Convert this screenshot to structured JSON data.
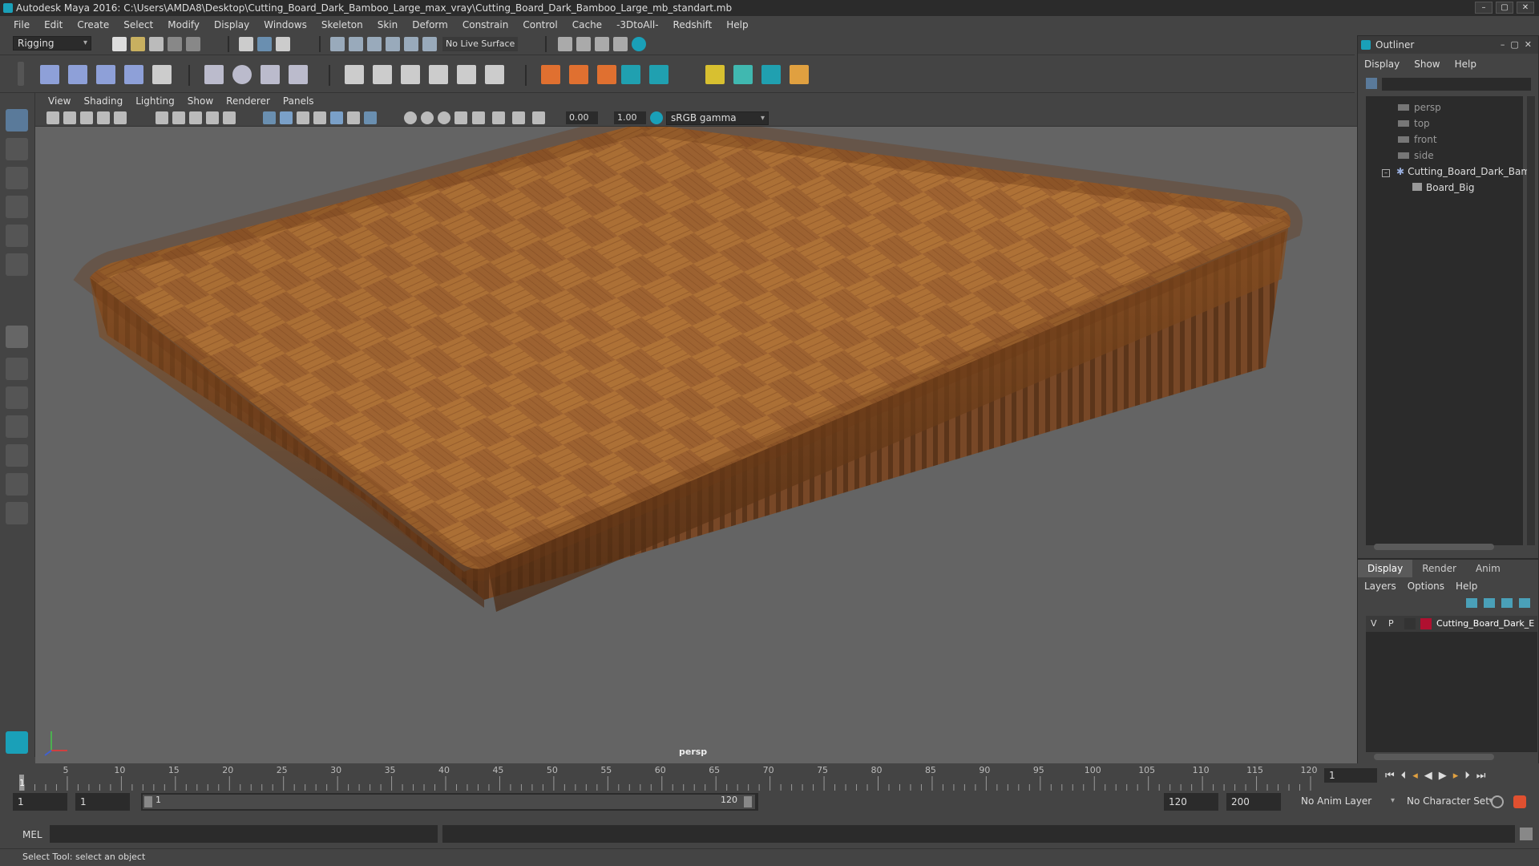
{
  "window": {
    "title": "Autodesk Maya 2016: C:\\Users\\AMDA8\\Desktop\\Cutting_Board_Dark_Bamboo_Large_max_vray\\Cutting_Board_Dark_Bamboo_Large_mb_standart.mb"
  },
  "menubar": [
    "File",
    "Edit",
    "Create",
    "Select",
    "Modify",
    "Display",
    "Windows",
    "Skeleton",
    "Skin",
    "Deform",
    "Constrain",
    "Control",
    "Cache",
    "-3DtoAll-",
    "Redshift",
    "Help"
  ],
  "statusline": {
    "mode": "Rigging",
    "live_surface": "No Live Surface"
  },
  "panel": {
    "menus": [
      "View",
      "Shading",
      "Lighting",
      "Show",
      "Renderer",
      "Panels"
    ],
    "near_value": "0.00",
    "far_value": "1.00",
    "color_space": "sRGB gamma",
    "camera_label": "persp"
  },
  "outliner": {
    "title": "Outliner",
    "menus": [
      "Display",
      "Show",
      "Help"
    ],
    "items": [
      "persp",
      "top",
      "front",
      "side",
      "Cutting_Board_Dark_Bam",
      "Board_Big"
    ]
  },
  "layers": {
    "tabs": [
      "Display",
      "Render",
      "Anim"
    ],
    "menus": [
      "Layers",
      "Options",
      "Help"
    ],
    "layer": {
      "v": "V",
      "p": "P",
      "name": "Cutting_Board_Dark_E",
      "color": "#b01030"
    }
  },
  "timeline": {
    "ticks": [
      "5",
      "10",
      "15",
      "20",
      "25",
      "30",
      "35",
      "40",
      "45",
      "50",
      "55",
      "60",
      "65",
      "70",
      "75",
      "80",
      "85",
      "90",
      "95",
      "100",
      "105",
      "110",
      "115",
      "120"
    ],
    "start_label": "1",
    "current_frame": "1"
  },
  "range": {
    "start": "1",
    "playback_start": "1",
    "slider_start": "1",
    "slider_end": "120",
    "playback_end": "120",
    "end": "200",
    "anim_layer": "No Anim Layer",
    "char_set": "No Character Set"
  },
  "command": {
    "lang": "MEL"
  },
  "help_line": "Select Tool: select an object",
  "colors": {
    "bg": "#444444",
    "viewport": "#646464",
    "accent": "#1aa0b8",
    "wood": "#a0602a"
  }
}
